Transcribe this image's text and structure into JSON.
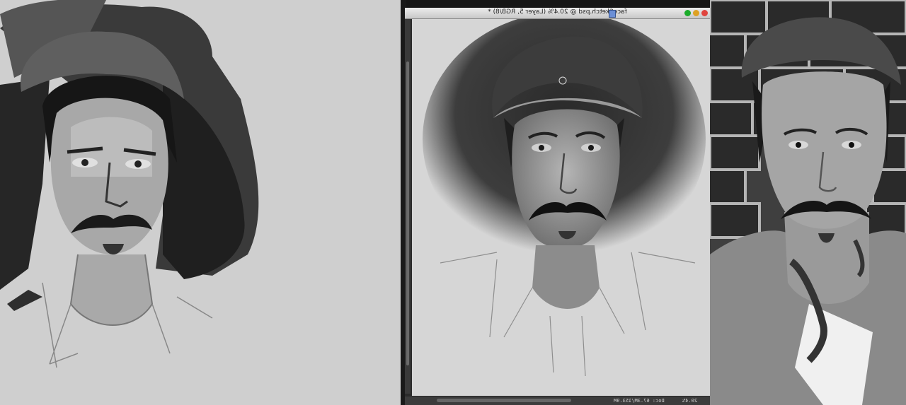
{
  "ps_window": {
    "title": "faceSketch.psd @ 20.4% (Layer 5, RGB/8) *",
    "status": {
      "zoom": "20.4%",
      "doc": "Doc: 67.3M/153.9M"
    }
  },
  "colors": {
    "left_canvas_bg": "#cfcfcf",
    "ps_canvas_bg": "#d6d6d6",
    "traffic_close": "#e0443e",
    "traffic_min": "#dea123",
    "traffic_max": "#1aab29"
  },
  "icons": {
    "close": "close-icon",
    "minimize": "minimize-icon",
    "maximize": "maximize-icon",
    "document": "document-icon"
  }
}
